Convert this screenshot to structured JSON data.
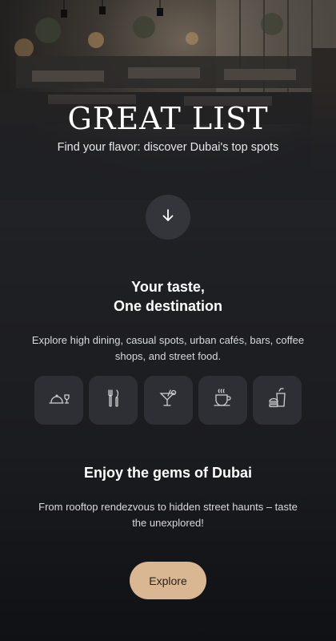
{
  "brand": {
    "name": "GREAT LIST"
  },
  "hero": {
    "tagline": "Find your flavor: discover Dubai's top spots"
  },
  "scroll": {
    "icon": "arrow-down-icon"
  },
  "section1": {
    "title_line1": "Your taste,",
    "title_line2": "One destination",
    "description": "Explore high dining, casual spots, urban cafés, bars, coffee shops, and street food."
  },
  "categories": [
    {
      "icon": "cloche-wine-icon"
    },
    {
      "icon": "fork-knife-icon"
    },
    {
      "icon": "cocktail-icon"
    },
    {
      "icon": "coffee-cup-icon"
    },
    {
      "icon": "fast-food-icon"
    }
  ],
  "section2": {
    "title": "Enjoy the gems of Dubai",
    "description": "From rooftop rendezvous to hidden street haunts – taste the unexplored!"
  },
  "cta": {
    "label": "Explore"
  },
  "colors": {
    "background": "#1f2024",
    "tile": "#2e2f34",
    "accent": "#d9b792"
  }
}
